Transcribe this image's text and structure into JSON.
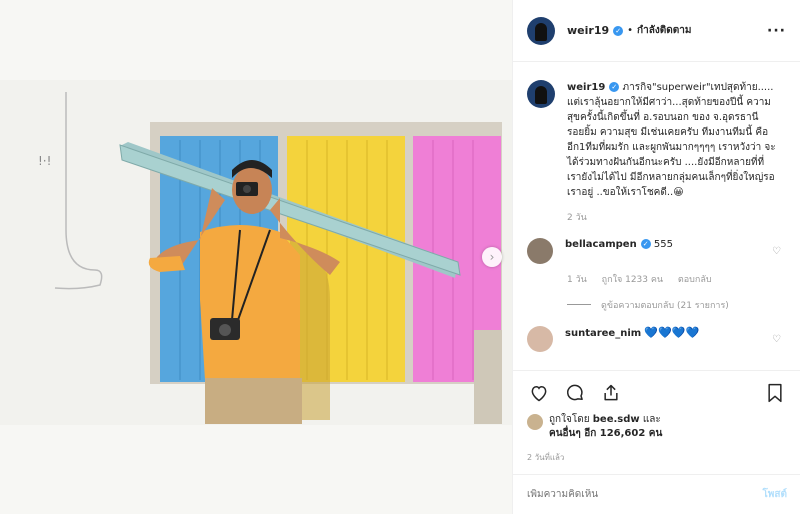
{
  "post": {
    "username": "weir19",
    "follow_label": "กำลังติดตาม",
    "dot": "•",
    "more_label": "···"
  },
  "caption": {
    "username": "weir19",
    "text": "ภารกิจ\"superweir\"เทปสุดท้าย..... แต่เราลุ้นอยากให้มีศาว่า...สุดท้ายของปีนี้ ความสุขครั้งนี้เกิดขึ้นที่ อ.รอบนอก ของ จ.อุดรธานี รอยยิ้ม ความสุข มีเช่นเคยครับ ทีมงานทีมนี้ คืออีก1ทีมที่ผมรัก และผูกพันมากๆๆๆๆ เราหวังว่า จะได้ร่วมทางฝันกันอีกนะครับ ....ยังมีอีกหลายที่ที่เรายังไม่ได้ไป มีอีกหลายกลุ่มคนเล็กๆที่ยิ่งใหญ่รอเราอยู่ ..ขอให้เราโชคดี..😀",
    "time": "2 วัน"
  },
  "comments": [
    {
      "username": "bellacampen",
      "text": "555",
      "time": "1 วัน",
      "likes": "ถูกใจ 1233 คน",
      "reply_label": "ตอบกลับ",
      "view_replies": "ดูข้อความตอบกลับ (21 รายการ)",
      "avatar_color": "#8a7a6a"
    },
    {
      "username": "suntaree_nim",
      "text": "💙💙💙💙",
      "avatar_color": "#d7b9a6"
    }
  ],
  "likes": {
    "prefix": "ถูกใจโดย",
    "liker": "bee.sdw",
    "and": "และ",
    "others": "คนอื่นๆ อีก 126,602 คน"
  },
  "post_time": "2 วันที่แล้ว",
  "add_comment": {
    "placeholder": "เพิ่มความคิดเห็น",
    "post_label": "โพสต์"
  },
  "icons": {
    "like": "heart-icon",
    "comment": "comment-icon",
    "share": "share-icon",
    "save": "bookmark-icon"
  },
  "colors": {
    "verified": "#3897f0",
    "post_button": "#b2dffc"
  }
}
